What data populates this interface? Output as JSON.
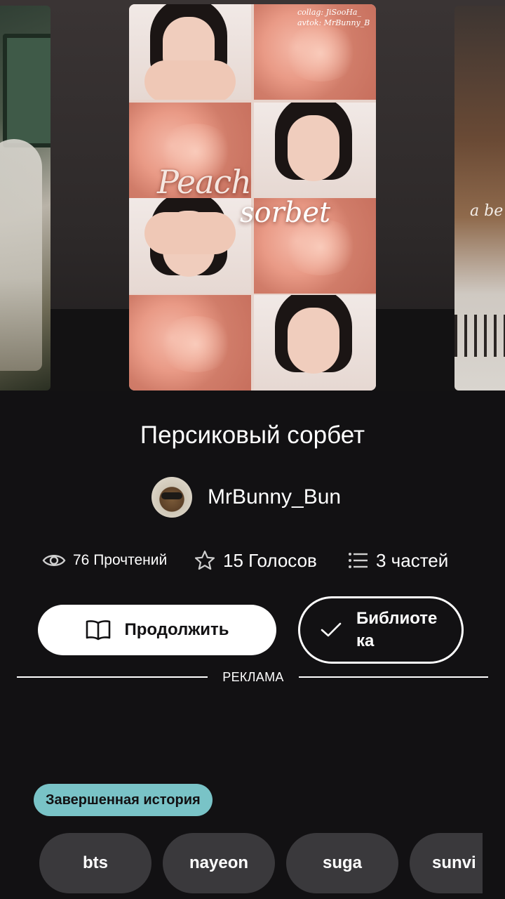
{
  "cover": {
    "title_line1": "Peach",
    "title_line2": "sorbet",
    "credits": "collag: JiSooHa_\navtok: MrBunny_B",
    "side_right_text": "a be"
  },
  "story": {
    "title": "Персиковый сорбет",
    "author": "MrBunny_Bun"
  },
  "stats": {
    "reads": "76 Прочтений",
    "votes": "15 Голосов",
    "parts": "3 частей",
    "icons": [
      "eye-icon",
      "star-icon",
      "list-icon"
    ]
  },
  "actions": {
    "continue_label": "Продолжить",
    "library_label": "Библиоте ка"
  },
  "ad": {
    "label": "РЕКЛАМА"
  },
  "status_badge": "Завершенная история",
  "tags": [
    "bts",
    "nayeon",
    "suga",
    "sunvi"
  ],
  "colors": {
    "background": "#121113",
    "badge": "#79c3c7",
    "tag": "#3a393c",
    "button": "#ffffff"
  }
}
